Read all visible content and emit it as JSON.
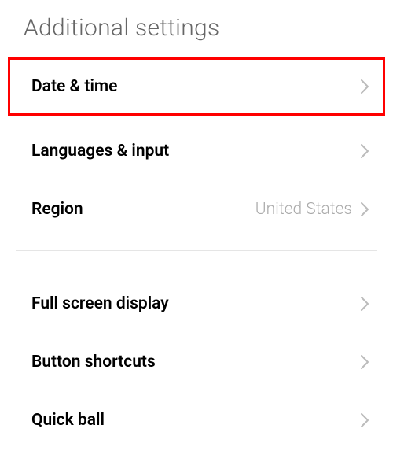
{
  "header": {
    "title": "Additional settings"
  },
  "items": [
    {
      "label": "Date & time",
      "value": "",
      "highlighted": true
    },
    {
      "label": "Languages & input",
      "value": "",
      "highlighted": false
    },
    {
      "label": "Region",
      "value": "United States",
      "highlighted": false
    }
  ],
  "items2": [
    {
      "label": "Full screen display",
      "value": ""
    },
    {
      "label": "Button shortcuts",
      "value": ""
    },
    {
      "label": "Quick ball",
      "value": ""
    }
  ]
}
